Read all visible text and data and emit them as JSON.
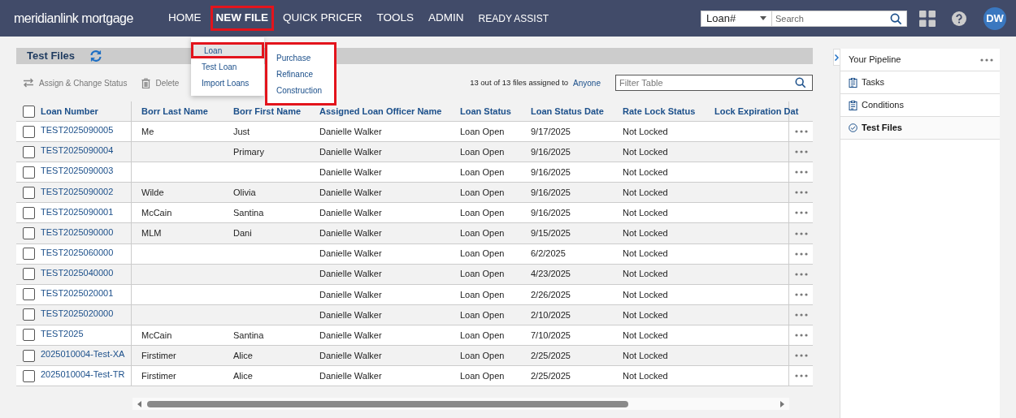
{
  "header": {
    "logo": "meridianlink mortgage",
    "nav": [
      {
        "label": "HOME",
        "kind": "main",
        "selected": false,
        "highlighted": false
      },
      {
        "label": "NEW FILE",
        "kind": "main",
        "selected": true,
        "highlighted": true
      },
      {
        "label": "QUICK PRICER",
        "kind": "main",
        "selected": false,
        "highlighted": false
      },
      {
        "label": "TOOLS",
        "kind": "main",
        "selected": false,
        "highlighted": false
      },
      {
        "label": "ADMIN",
        "kind": "main",
        "selected": false,
        "highlighted": false
      },
      {
        "label": "READY ASSIST",
        "kind": "secondary",
        "selected": false,
        "highlighted": false
      }
    ],
    "search": {
      "scope": "Loan#",
      "placeholder": "Search"
    },
    "avatar": "DW"
  },
  "new_file_menu": {
    "items": [
      {
        "label": "Loan",
        "selected": true,
        "highlighted": true
      },
      {
        "label": "Test Loan",
        "selected": false,
        "highlighted": false
      },
      {
        "label": "Import Loans",
        "selected": false,
        "highlighted": false
      }
    ],
    "submenu": {
      "highlighted": true,
      "items": [
        "Purchase",
        "Refinance",
        "Construction"
      ]
    }
  },
  "page": {
    "title": "Test Files",
    "toolbar": {
      "actions": [
        {
          "label": "Assign & Change Status",
          "kind": "assign"
        },
        {
          "label": "Delete",
          "kind": "delete"
        }
      ],
      "count_text": "13 out of 13 files assigned to",
      "assignee": "Anyone",
      "filter_placeholder": "Filter Table"
    }
  },
  "table": {
    "columns": [
      "Loan Number",
      "Borr Last Name",
      "Borr First Name",
      "Assigned Loan Officer Name",
      "Loan Status",
      "Loan Status Date",
      "Rate Lock Status",
      "Lock Expiration Dat"
    ],
    "header_checked": false,
    "rows": [
      {
        "checked": false,
        "cells": [
          "TEST2025090005",
          "Me",
          "Just",
          "Danielle Walker",
          "Loan Open",
          "9/17/2025",
          "Not Locked",
          ""
        ]
      },
      {
        "checked": false,
        "cells": [
          "TEST2025090004",
          "",
          "Primary",
          "Danielle Walker",
          "Loan Open",
          "9/16/2025",
          "Not Locked",
          ""
        ]
      },
      {
        "checked": false,
        "cells": [
          "TEST2025090003",
          "",
          "",
          "Danielle Walker",
          "Loan Open",
          "9/16/2025",
          "Not Locked",
          ""
        ]
      },
      {
        "checked": false,
        "cells": [
          "TEST2025090002",
          "Wilde",
          "Olivia",
          "Danielle Walker",
          "Loan Open",
          "9/16/2025",
          "Not Locked",
          ""
        ]
      },
      {
        "checked": false,
        "cells": [
          "TEST2025090001",
          "McCain",
          "Santina",
          "Danielle Walker",
          "Loan Open",
          "9/16/2025",
          "Not Locked",
          ""
        ]
      },
      {
        "checked": false,
        "cells": [
          "TEST2025090000",
          "MLM",
          "Dani",
          "Danielle Walker",
          "Loan Open",
          "9/15/2025",
          "Not Locked",
          ""
        ]
      },
      {
        "checked": false,
        "cells": [
          "TEST2025060000",
          "",
          "",
          "Danielle Walker",
          "Loan Open",
          "6/2/2025",
          "Not Locked",
          ""
        ]
      },
      {
        "checked": false,
        "cells": [
          "TEST2025040000",
          "",
          "",
          "Danielle Walker",
          "Loan Open",
          "4/23/2025",
          "Not Locked",
          ""
        ]
      },
      {
        "checked": false,
        "cells": [
          "TEST2025020001",
          "",
          "",
          "Danielle Walker",
          "Loan Open",
          "2/26/2025",
          "Not Locked",
          ""
        ]
      },
      {
        "checked": false,
        "cells": [
          "TEST2025020000",
          "",
          "",
          "Danielle Walker",
          "Loan Open",
          "2/10/2025",
          "Not Locked",
          ""
        ]
      },
      {
        "checked": false,
        "cells": [
          "TEST2025",
          "McCain",
          "Santina",
          "Danielle Walker",
          "Loan Open",
          "7/10/2025",
          "Not Locked",
          ""
        ]
      },
      {
        "checked": false,
        "cells": [
          "2025010004-Test-XA",
          "Firstimer",
          "Alice",
          "Danielle Walker",
          "Loan Open",
          "2/25/2025",
          "Not Locked",
          ""
        ]
      },
      {
        "checked": false,
        "cells": [
          "2025010004-Test-TR",
          "Firstimer",
          "Alice",
          "Danielle Walker",
          "Loan Open",
          "2/25/2025",
          "Not Locked",
          ""
        ]
      }
    ]
  },
  "sidebar": {
    "items": [
      {
        "label": "Your Pipeline",
        "kind": "header",
        "selected": false
      },
      {
        "label": "Tasks",
        "kind": "list",
        "selected": false
      },
      {
        "label": "Conditions",
        "kind": "list",
        "selected": false
      },
      {
        "label": "Test Files",
        "kind": "check",
        "selected": true
      }
    ]
  }
}
